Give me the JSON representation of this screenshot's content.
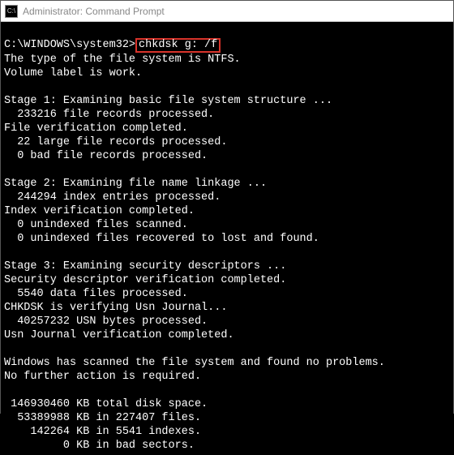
{
  "titlebar": {
    "icon_label": "C:\\",
    "title": "Administrator: Command Prompt"
  },
  "prompt": "C:\\WINDOWS\\system32>",
  "command": "chkdsk g: /f",
  "lines": {
    "l1": "The type of the file system is NTFS.",
    "l2": "Volume label is work.",
    "l3": "",
    "l4": "Stage 1: Examining basic file system structure ...",
    "l5": "  233216 file records processed.",
    "l6": "File verification completed.",
    "l7": "  22 large file records processed.",
    "l8": "  0 bad file records processed.",
    "l9": "",
    "l10": "Stage 2: Examining file name linkage ...",
    "l11": "  244294 index entries processed.",
    "l12": "Index verification completed.",
    "l13": "  0 unindexed files scanned.",
    "l14": "  0 unindexed files recovered to lost and found.",
    "l15": "",
    "l16": "Stage 3: Examining security descriptors ...",
    "l17": "Security descriptor verification completed.",
    "l18": "  5540 data files processed.",
    "l19": "CHKDSK is verifying Usn Journal...",
    "l20": "  40257232 USN bytes processed.",
    "l21": "Usn Journal verification completed.",
    "l22": "",
    "l23": "Windows has scanned the file system and found no problems.",
    "l24": "No further action is required.",
    "l25": "",
    "l26": " 146930460 KB total disk space.",
    "l27": "  53389988 KB in 227407 files.",
    "l28": "    142264 KB in 5541 indexes.",
    "l29": "         0 KB in bad sectors."
  }
}
